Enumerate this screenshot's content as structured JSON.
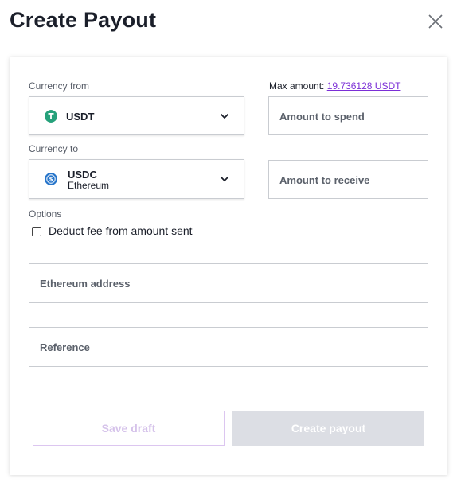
{
  "header": {
    "title": "Create Payout",
    "close_icon": "close-icon"
  },
  "form": {
    "currency_from": {
      "label": "Currency from",
      "selected": "USDT",
      "icon": "tether-icon",
      "icon_color": "#26a17b"
    },
    "currency_to": {
      "label": "Currency to",
      "selected": "USDC",
      "network": "Ethereum",
      "icon": "usdc-icon",
      "icon_color": "#2775ca"
    },
    "max_amount": {
      "prefix": "Max amount:",
      "value": "19.736128 USDT"
    },
    "amount_to_spend": {
      "placeholder": "Amount to spend"
    },
    "amount_to_receive": {
      "placeholder": "Amount to receive"
    },
    "options": {
      "label": "Options",
      "deduct_fee_label": "Deduct fee from amount sent",
      "deduct_fee_checked": false
    },
    "address": {
      "placeholder": "Ethereum address"
    },
    "reference": {
      "placeholder": "Reference"
    }
  },
  "actions": {
    "save_draft": "Save draft",
    "create_payout": "Create payout",
    "accent_color": "#7b2fd6"
  }
}
